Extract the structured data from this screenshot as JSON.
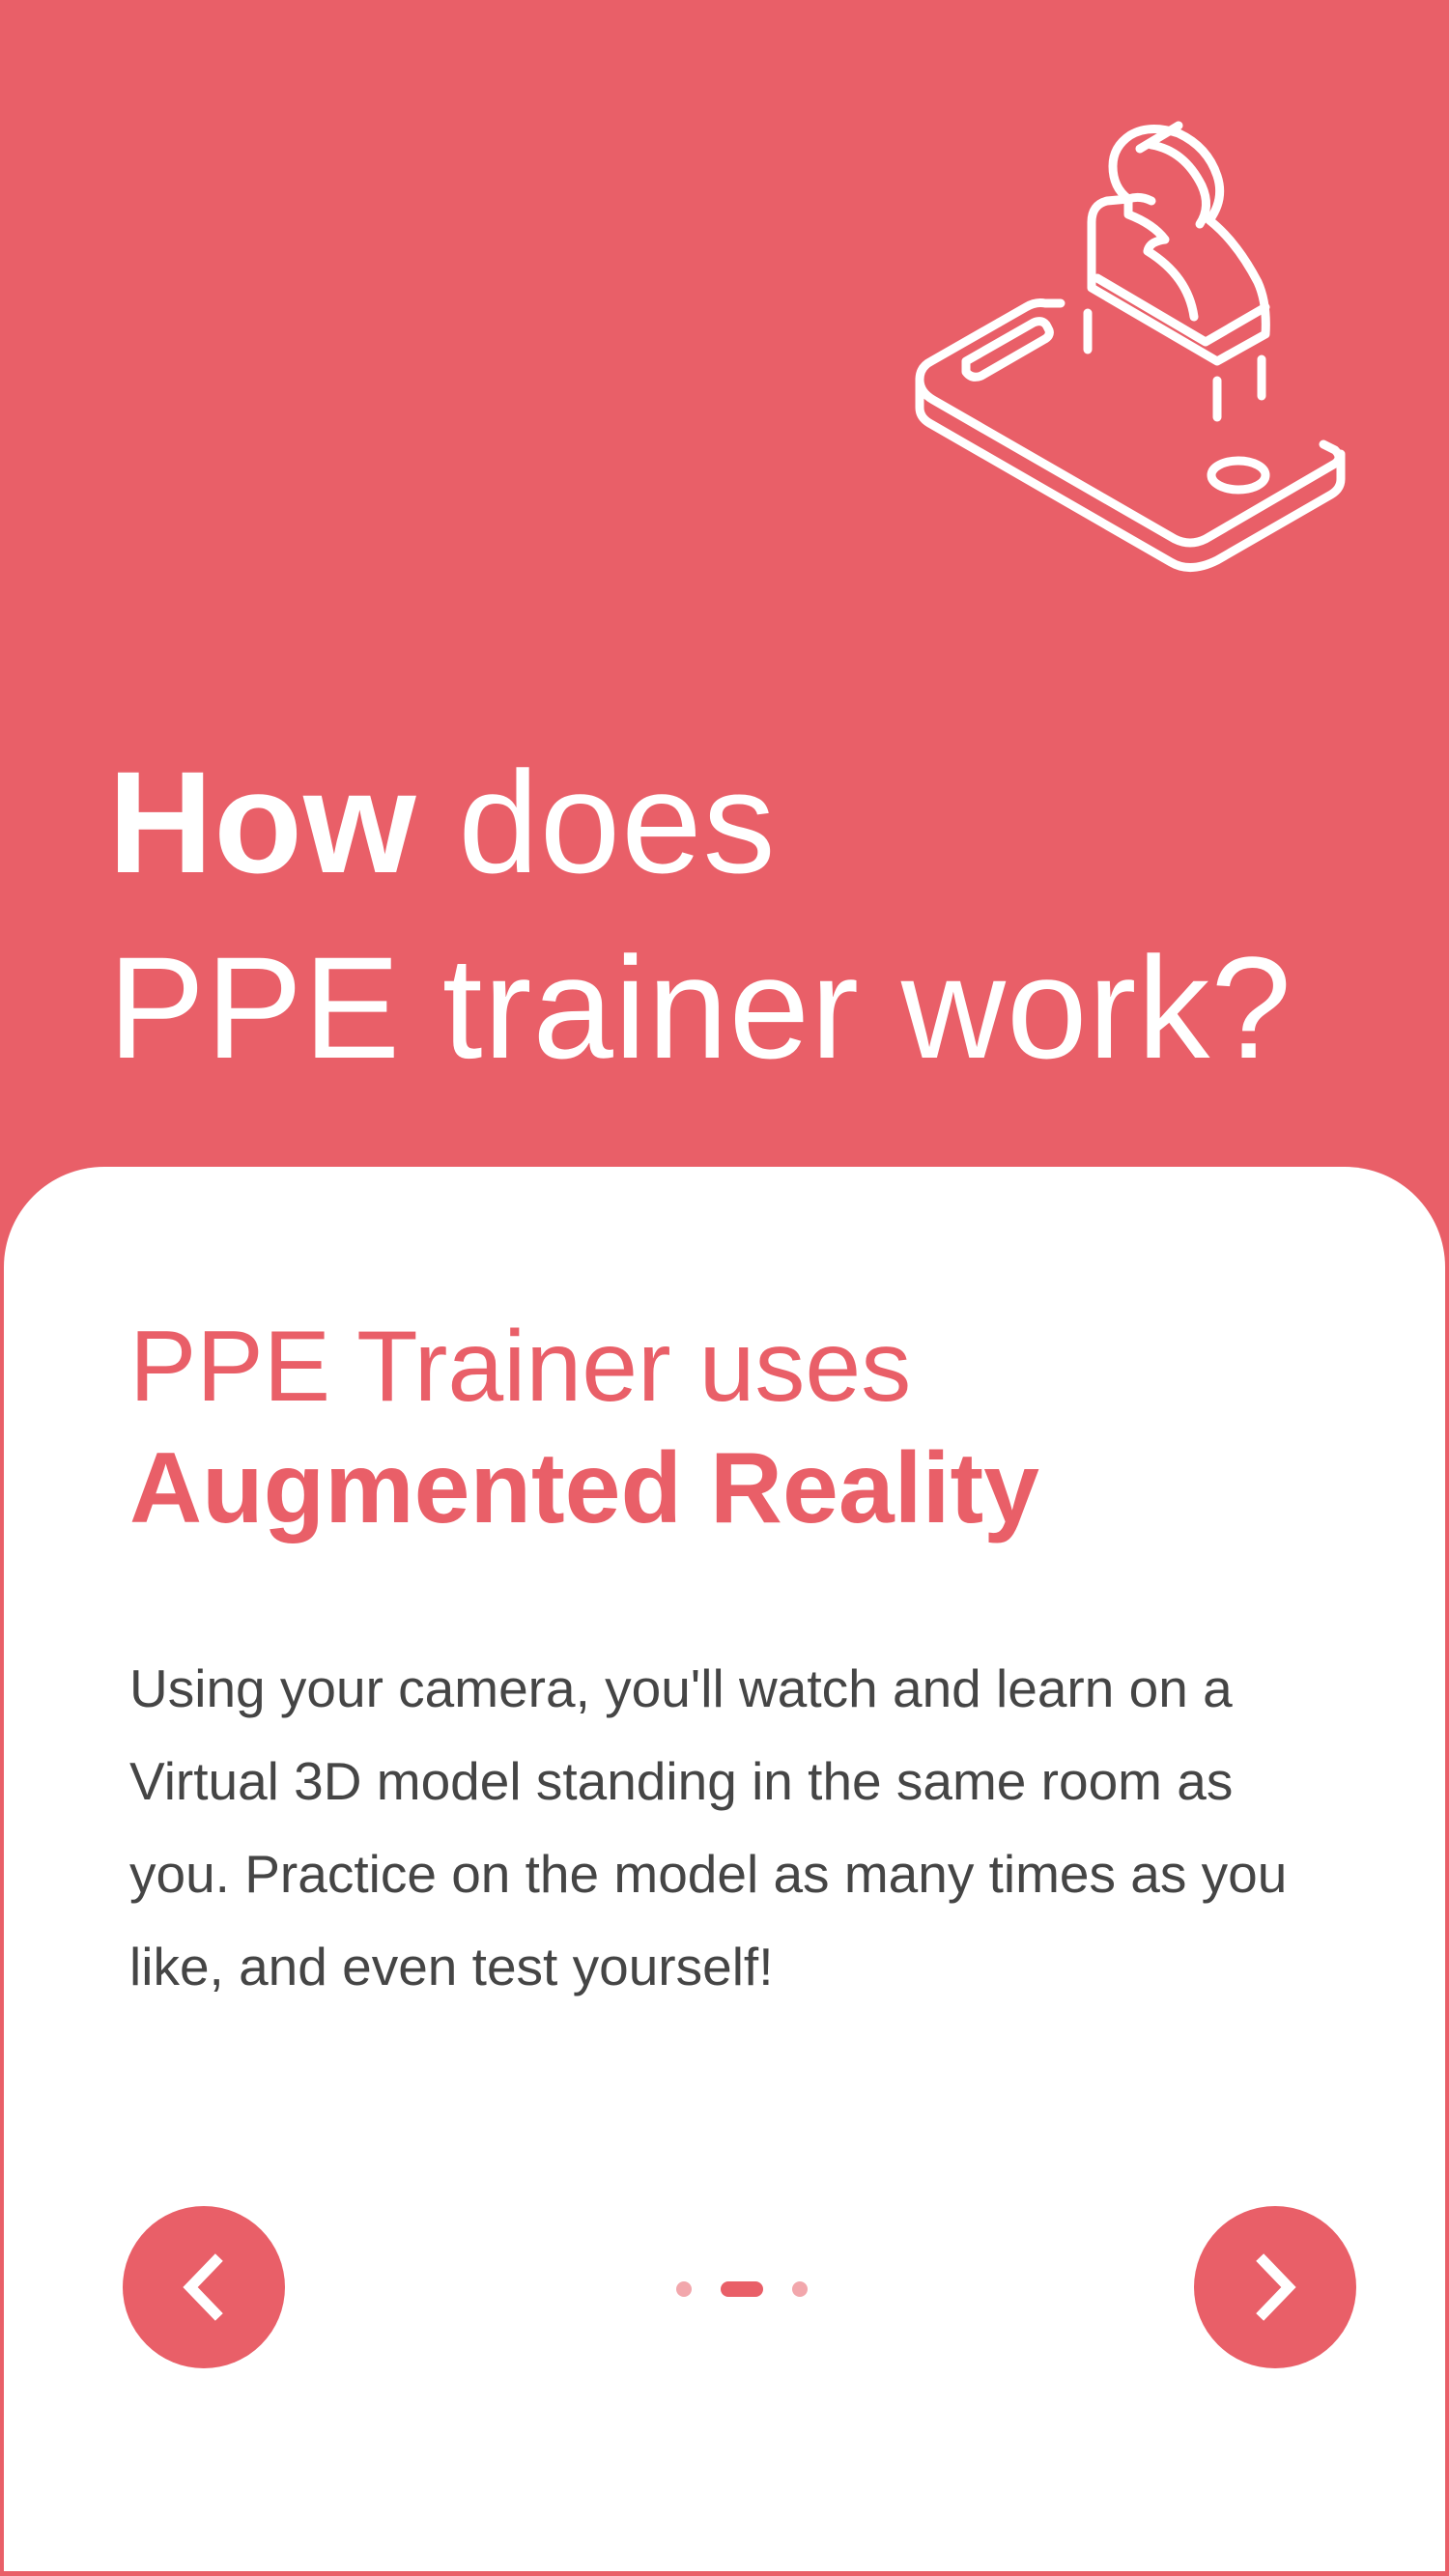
{
  "theme": {
    "accent": "#E95F68",
    "card_background": "#FFFFFF",
    "body_text": "#454545",
    "dot_inactive": "#F2A7AC"
  },
  "hero": {
    "illustration_icon": "phone-ar-person-icon",
    "title_word_how": "How",
    "title_word_does": "does",
    "title_word_ppe_trainer": "PPE trainer",
    "title_word_work": "work?"
  },
  "card": {
    "heading_line1": "PPE Trainer uses",
    "heading_line2": "Augmented Reality",
    "body": "Using your camera, you'll watch and learn on a Virtual 3D model standing  in the same room as you. Practice on the model as many times as you like, and even test yourself!"
  },
  "navigation": {
    "prev_icon": "chevron-left-icon",
    "next_icon": "chevron-right-icon",
    "total_pages": 3,
    "current_page": 2
  }
}
